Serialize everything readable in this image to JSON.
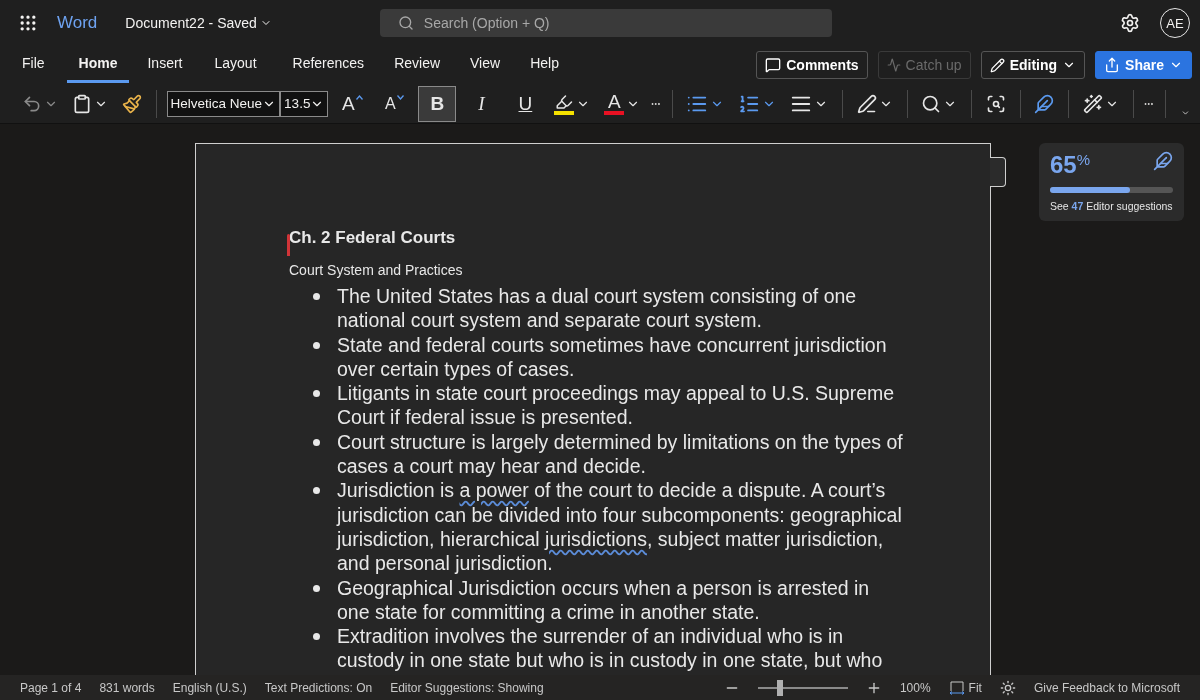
{
  "app": {
    "name": "Word",
    "document": "Document22",
    "separator": "-",
    "status": "Saved"
  },
  "search": {
    "placeholder": "Search (Option + Q)"
  },
  "account": {
    "initials": "AE"
  },
  "tabs": [
    {
      "label": "File",
      "selected": false
    },
    {
      "label": "Home",
      "selected": true
    },
    {
      "label": "Insert",
      "selected": false
    },
    {
      "label": "Layout",
      "selected": false
    },
    {
      "label": "References",
      "selected": false
    },
    {
      "label": "Review",
      "selected": false
    },
    {
      "label": "View",
      "selected": false
    },
    {
      "label": "Help",
      "selected": false
    }
  ],
  "actions": [
    {
      "label": "Comments",
      "kind": "comments",
      "disabled": false
    },
    {
      "label": "Catch up",
      "kind": "catchup",
      "disabled": true
    },
    {
      "label": "Editing",
      "kind": "editing",
      "disabled": false
    },
    {
      "label": "Share",
      "kind": "share",
      "disabled": false
    }
  ],
  "toolbar": {
    "font": "Helvetica Neue",
    "size": "13.5",
    "grow": "A",
    "shrink": "A",
    "font_color": "A",
    "format_buttons": [
      {
        "label": "B",
        "kind": "bold",
        "selected": true
      },
      {
        "label": "I",
        "kind": "italic",
        "selected": false
      },
      {
        "label": "U",
        "kind": "underline",
        "selected": false
      }
    ]
  },
  "document": {
    "heading": "Ch. 2 Federal Courts",
    "subheading": "Court System and Practices",
    "bullets": [
      {
        "segments": [
          {
            "text": "The United States has a dual court system consisting of one national court system and separate court system.",
            "flagged": false
          }
        ]
      },
      {
        "segments": [
          {
            "text": "State and federal courts sometimes have concurrent jurisdiction over certain types of cases.",
            "flagged": false
          }
        ]
      },
      {
        "segments": [
          {
            "text": "Litigants in state court proceedings may appeal to U.S. Supreme Court if federal issue is presented.",
            "flagged": false
          }
        ]
      },
      {
        "segments": [
          {
            "text": "Court structure is largely determined by limitations on the types of cases a court may hear and decide.",
            "flagged": false
          }
        ]
      },
      {
        "segments": [
          {
            "text": "Jurisdiction is ",
            "flagged": false
          },
          {
            "text": "a power",
            "flagged": true
          },
          {
            "text": " of the court to decide a dispute. A court’s jurisdiction can be divided into four subcomponents: geographical jurisdiction, hierarchical ",
            "flagged": false
          },
          {
            "text": "jurisdictions",
            "flagged": true
          },
          {
            "text": ", subject matter jurisdiction, and personal jurisdiction.",
            "flagged": false
          }
        ]
      },
      {
        "segments": [
          {
            "text": "Geographical Jurisdiction occurs when a person is arrested in one state for committing a crime in another state.",
            "flagged": false
          }
        ]
      },
      {
        "segments": [
          {
            "text": "Extradition involves the surrender of an individual who is in custody in one state but who is in custody in one state, but who",
            "flagged": false
          }
        ]
      }
    ]
  },
  "editor_card": {
    "score": "65",
    "unit": "%",
    "level": 0.65,
    "prefix": "See",
    "count": "47",
    "suffix": "Editor suggestions"
  },
  "status_bar": {
    "items": [
      "Page 1 of 4",
      "831 words",
      "English (U.S.)",
      "Text Predictions: On",
      "Editor Suggestions: Showing"
    ],
    "zoom_slider": {
      "level": 0.25
    },
    "zoom": "100%",
    "fit": "Fit",
    "feedback": "Give Feedback to Microsoft"
  }
}
